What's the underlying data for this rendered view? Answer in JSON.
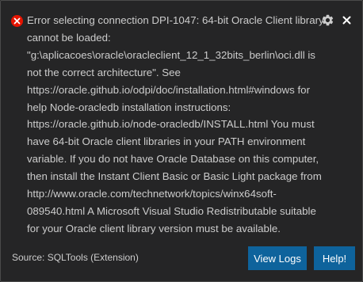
{
  "notification": {
    "severity": "error",
    "message_lines": [
      "Error selecting connection DPI-1047: 64-bit Oracle Client library",
      "cannot be loaded:",
      "\"g:\\aplicacoes\\oracle\\oracleclient_12_1_32bits_berlin\\oci.dll is",
      "not the correct architecture\". See",
      "https://oracle.github.io/odpi/doc/installation.html#windows for",
      "help Node-oracledb installation instructions:",
      "https://oracle.github.io/node-oracledb/INSTALL.html You must",
      "have 64-bit Oracle client libraries in your PATH environment",
      "variable. If you do not have Oracle Database on this computer,",
      "then install the Instant Client Basic or Basic Light package from",
      "http://www.oracle.com/technetwork/topics/winx64soft-",
      "089540.html A Microsoft Visual Studio Redistributable suitable",
      "for your Oracle client library version must be available."
    ],
    "source": "Source: SQLTools (Extension)",
    "buttons": {
      "view_logs": "View Logs",
      "help": "Help!"
    },
    "icons": {
      "error": "error-icon",
      "settings": "gear-icon",
      "close": "close-icon"
    }
  },
  "colors": {
    "background": "#252526",
    "border": "#4a4a4a",
    "text": "#cccccc",
    "error": "#e51400",
    "button": "#0e639c",
    "button_text": "#ffffff"
  }
}
